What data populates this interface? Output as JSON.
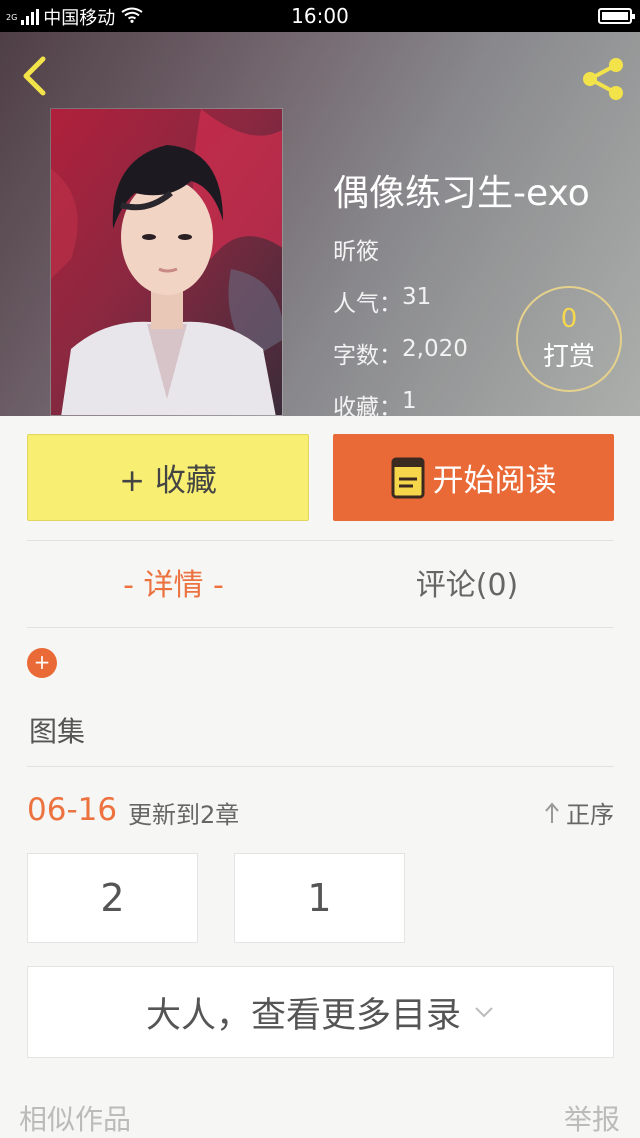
{
  "status_bar": {
    "network_type": "2G",
    "carrier": "中国移动",
    "time": "16:00"
  },
  "colors": {
    "accent_orange": "#e96a36",
    "collect_yellow": "#f8ef72",
    "tip_gold": "#f5d750"
  },
  "header": {
    "back_icon": "chevron-left-icon",
    "share_icon": "share-icon"
  },
  "book": {
    "title": "偶像练习生-exo",
    "author": "昕筱",
    "popularity_label": "人气：",
    "popularity": "31",
    "words_label": "字数：",
    "words": "2,020",
    "favorites_label": "收藏：",
    "favorites": "1",
    "tip_count": "0",
    "tip_label": "打赏"
  },
  "actions": {
    "collect_label": "+ 收藏",
    "read_label": "开始阅读"
  },
  "tabs": {
    "details": "- 详情 -",
    "comments": "评论(0)"
  },
  "details": {
    "gallery_label": "图集"
  },
  "updates": {
    "date": "06-16",
    "text": "更新到2章",
    "sort_label": "正序"
  },
  "chapters": [
    "2",
    "1"
  ],
  "more_toc": "大人，查看更多目录",
  "footer": {
    "similar": "相似作品",
    "report": "举报"
  }
}
